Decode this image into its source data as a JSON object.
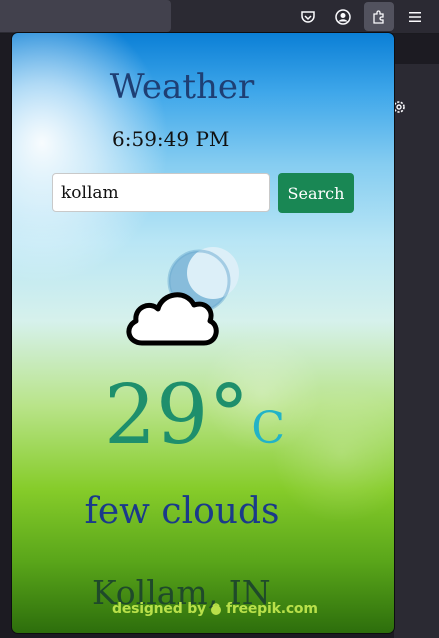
{
  "browser": {
    "toolbar_icons": [
      "pocket-icon",
      "account-icon",
      "extensions-icon",
      "menu-icon"
    ]
  },
  "app": {
    "title": "Weather",
    "clock": "6:59:49 PM",
    "search": {
      "value": "kollam",
      "button_label": "Search"
    },
    "weather": {
      "icon": "cloud-moon-icon",
      "temperature": "29°",
      "unit": "C",
      "condition": "few clouds",
      "location": "Kollam, IN"
    },
    "credit": {
      "prefix": "designed by",
      "brand": "freepik.com"
    },
    "colors": {
      "title": "#1e3f74",
      "button": "#198754",
      "temperature": "#1e8f6c",
      "unit": "#22b3c7",
      "condition": "#1a3a8a"
    }
  }
}
